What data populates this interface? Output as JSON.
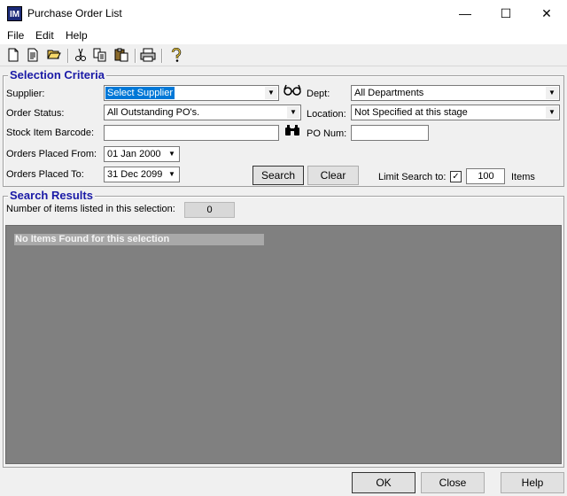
{
  "window": {
    "title": "Purchase Order List",
    "icon_text": "IM",
    "minimize_glyph": "—",
    "maximize_glyph": "☐",
    "close_glyph": "✕"
  },
  "menu": {
    "file": "File",
    "edit": "Edit",
    "help": "Help"
  },
  "toolbar": {
    "icons": [
      "new-icon",
      "document-icon",
      "open-folder-icon",
      "cut-icon",
      "copy-icon",
      "paste-icon",
      "print-icon",
      "help-icon"
    ]
  },
  "selection_criteria": {
    "title": "Selection Criteria",
    "supplier_label": "Supplier:",
    "supplier_value": "Select Supplier",
    "dept_label": "Dept:",
    "dept_value": "All Departments",
    "order_status_label": "Order Status:",
    "order_status_value": "All Outstanding PO's.",
    "location_label": "Location:",
    "location_value": "Not Specified at this stage",
    "barcode_label": "Stock Item Barcode:",
    "barcode_value": "",
    "po_num_label": "PO Num:",
    "po_num_value": "",
    "orders_from_label": "Orders Placed From:",
    "orders_from_value": "01 Jan 2000",
    "orders_to_label": "Orders Placed To:",
    "orders_to_value": "31 Dec 2099",
    "search_button": "Search",
    "clear_button": "Clear",
    "limit_label": "Limit Search to:",
    "limit_checked": true,
    "limit_value": "100",
    "items_label": "Items"
  },
  "search_results": {
    "title": "Search Results",
    "count_label": "Number of items listed in this selection:",
    "count_value": "0",
    "empty_message": "No Items Found for this selection"
  },
  "footer": {
    "ok_button": "OK",
    "close_button": "Close",
    "help_button": "Help"
  }
}
